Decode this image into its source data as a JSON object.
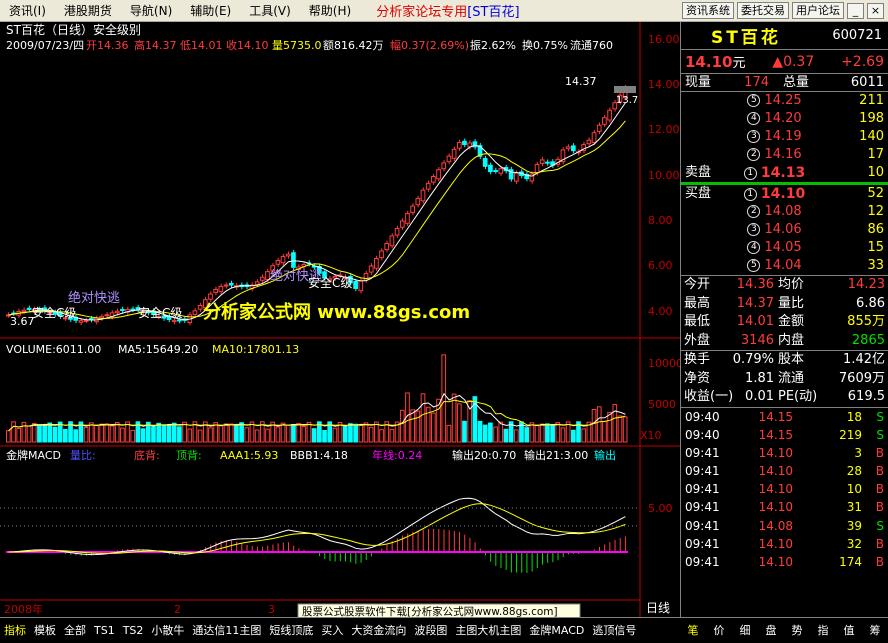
{
  "menu": {
    "items": [
      "资讯(I)",
      "港股期货",
      "导航(N)",
      "辅助(E)",
      "工具(V)",
      "帮助(H)"
    ],
    "brand": "分析家论坛专用",
    "brand_stock": "[ST百花]",
    "buttons": [
      "资讯系统",
      "委托交易",
      "用户论坛"
    ],
    "win_min": "_",
    "win_close": "×"
  },
  "chart_header": {
    "title": "ST百花（日线）安全级别",
    "date": "2009/07/23/四",
    "open": "开14.36",
    "high": "高14.37",
    "low": "低14.01",
    "close": "收14.10",
    "vol": "量5735.0",
    "amt": "额816.42万",
    "amp": "幅0.37(2.69%)",
    "zhen": "振2.62%",
    "huan": "换0.75%",
    "liu": "流通760"
  },
  "annotations": {
    "high_label": "14.37",
    "cur_label": "13.7",
    "low_label": "3.67",
    "signal1": "绝对快逃",
    "signal2": "绝对快逃",
    "level1": "安全C级",
    "level2": "安全C级",
    "level3": "安全C级",
    "watermark": "分析家公式网 www.88gs.com"
  },
  "volume_header": {
    "vol": "VOLUME:6011.00",
    "ma5": "MA5:15649.20",
    "ma10": "MA10:17801.13"
  },
  "macd_header": {
    "name": "金牌MACD",
    "i1": "量比:",
    "i2": "底背:",
    "i3": "顶背:",
    "i4": "AAA1:5.93",
    "i5": "BBB1:4.18",
    "i6": "年线:0.24",
    "i7": "输出20:0.70",
    "i8": "输出21:3.00",
    "i9": "输出"
  },
  "axis": {
    "price_ticks": [
      "16.00",
      "14.00",
      "12.00",
      "10.00",
      "8.00",
      "6.00",
      "4.00"
    ],
    "vol_ticks": [
      "10000",
      "5000"
    ],
    "vol_unit": "X10",
    "macd_tick": "5.00",
    "x_labels": [
      "2008年",
      "2",
      "3"
    ],
    "period": "日线"
  },
  "banner": "股票公式股票软件下载[分析家公式网www.88gs.com]",
  "quote": {
    "name": "ST百花",
    "code": "600721",
    "price": "14.10",
    "price_unit": "元",
    "change": "▲0.37",
    "change_pct": "+2.69",
    "now_vol_label": "现量",
    "now_vol": "174",
    "total_vol_label": "总量",
    "total_vol": "6011",
    "sell_label": "卖盘",
    "buy_label": "买盘",
    "sell": [
      {
        "n": "5",
        "p": "14.25",
        "v": "211"
      },
      {
        "n": "4",
        "p": "14.20",
        "v": "198"
      },
      {
        "n": "3",
        "p": "14.19",
        "v": "140"
      },
      {
        "n": "2",
        "p": "14.16",
        "v": "17"
      },
      {
        "n": "1",
        "p": "14.13",
        "v": "10"
      }
    ],
    "buy": [
      {
        "n": "1",
        "p": "14.10",
        "v": "52"
      },
      {
        "n": "2",
        "p": "14.08",
        "v": "12"
      },
      {
        "n": "3",
        "p": "14.06",
        "v": "86"
      },
      {
        "n": "4",
        "p": "14.05",
        "v": "15"
      },
      {
        "n": "5",
        "p": "14.04",
        "v": "33"
      }
    ],
    "stats1": [
      {
        "l1": "今开",
        "v1": "14.36",
        "c1": "red",
        "l2": "均价",
        "v2": "14.23",
        "c2": "red"
      },
      {
        "l1": "最高",
        "v1": "14.37",
        "c1": "red",
        "l2": "量比",
        "v2": "6.86",
        "c2": "white"
      },
      {
        "l1": "最低",
        "v1": "14.01",
        "c1": "red",
        "l2": "金额",
        "v2": "855万",
        "c2": "yellow"
      },
      {
        "l1": "外盘",
        "v1": "3146",
        "c1": "red",
        "l2": "内盘",
        "v2": "2865",
        "c2": "green"
      }
    ],
    "stats2": [
      {
        "l1": "换手",
        "v1": "0.79%",
        "c1": "white",
        "l2": "股本",
        "v2": "1.42亿",
        "c2": "white"
      },
      {
        "l1": "净资",
        "v1": "1.81",
        "c1": "white",
        "l2": "流通",
        "v2": "7609万",
        "c2": "white"
      },
      {
        "l1": "收益(一)",
        "v1": "0.01",
        "c1": "white",
        "l2": "PE(动)",
        "v2": "619.5",
        "c2": "white"
      }
    ],
    "ticks": [
      {
        "t": "09:40",
        "p": "14.15",
        "v": "18",
        "s": "S",
        "pc": "red",
        "sc": "green"
      },
      {
        "t": "09:40",
        "p": "14.15",
        "v": "219",
        "s": "S",
        "pc": "red",
        "sc": "green"
      },
      {
        "t": "09:41",
        "p": "14.10",
        "v": "3",
        "s": "B",
        "pc": "red",
        "sc": "red"
      },
      {
        "t": "09:41",
        "p": "14.10",
        "v": "28",
        "s": "B",
        "pc": "red",
        "sc": "red"
      },
      {
        "t": "09:41",
        "p": "14.10",
        "v": "10",
        "s": "B",
        "pc": "red",
        "sc": "red"
      },
      {
        "t": "09:41",
        "p": "14.10",
        "v": "31",
        "s": "B",
        "pc": "red",
        "sc": "red"
      },
      {
        "t": "09:41",
        "p": "14.08",
        "v": "39",
        "s": "S",
        "pc": "red",
        "sc": "green"
      },
      {
        "t": "09:41",
        "p": "14.10",
        "v": "32",
        "s": "B",
        "pc": "red",
        "sc": "red"
      },
      {
        "t": "09:41",
        "p": "14.10",
        "v": "174",
        "s": "B",
        "pc": "red",
        "sc": "red"
      }
    ]
  },
  "bottom_tabs": [
    "指标",
    "模板",
    "全部",
    "TS1",
    "TS2",
    "小散牛",
    "通达信11主图",
    "短线顶底",
    "买入",
    "大资金流向",
    "波段图",
    "主图大机主图",
    "金牌MACD",
    "逃顶信号"
  ],
  "right_tabs": [
    "笔",
    "价",
    "细",
    "盘",
    "势",
    "指",
    "值",
    "筹"
  ],
  "colors": {
    "up": "#ff3c3c",
    "down": "#00ffff",
    "ma_white": "#ffffff",
    "ma_yellow": "#ffff00",
    "macd_magenta": "#ff00ff",
    "axis_red": "#c00000",
    "signal": "#b090ff",
    "watermark": "#ffff00"
  }
}
